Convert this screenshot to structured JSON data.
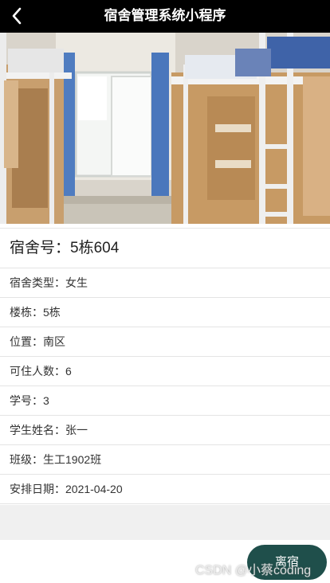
{
  "navbar": {
    "title": "宿舍管理系统小程序",
    "back_icon": "chevron-left-icon"
  },
  "banner": {
    "image": "dormitory-room-photo",
    "indicator_active": "#f5b01e"
  },
  "room": {
    "number": "宿舍号：5栋604",
    "type": "宿舍类型：女生",
    "building": "楼栋：5栋",
    "location": "位置：南区",
    "capacity": "可住人数：6",
    "student_id": "学号：3",
    "student_name": "学生姓名：张一",
    "class_name": "班级：生工1902班",
    "arrange_date": "安排日期：2021-04-20"
  },
  "actions": {
    "leave_label": "离宿",
    "leave_color": "#1f4f4b"
  },
  "watermark": "CSDN @小蔡coding"
}
